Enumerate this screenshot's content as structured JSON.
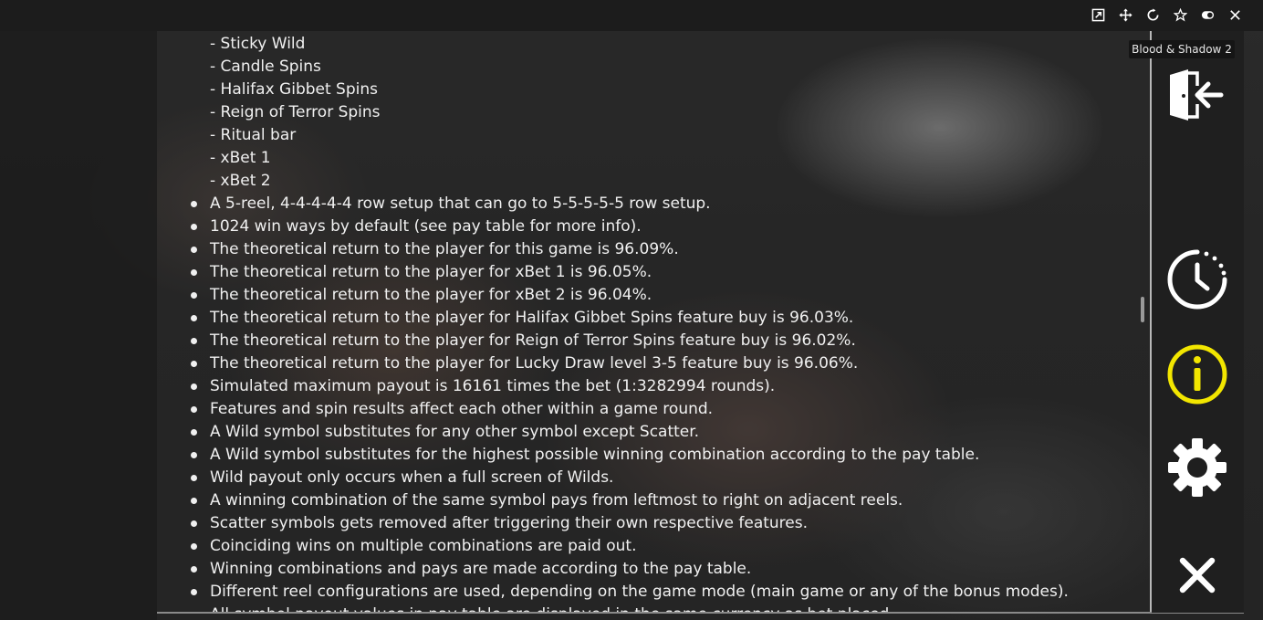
{
  "window": {
    "title": "Blood & Shadow 2",
    "top_controls": [
      "external-link-icon",
      "move-icon",
      "refresh-icon",
      "star-icon",
      "toggle-icon",
      "close-icon"
    ]
  },
  "help": {
    "sub_items": [
      "- Sticky Wild",
      "- Candle Spins",
      "- Halifax Gibbet Spins",
      "- Reign of Terror Spins",
      "- Ritual bar",
      "- xBet 1",
      "- xBet 2"
    ],
    "bullets": [
      "A 5-reel, 4-4-4-4-4 row setup that can go to 5-5-5-5-5 row setup.",
      "1024 win ways by default (see pay table for more info).",
      "The theoretical return to the player for this game is 96.09%.",
      "The theoretical return to the player for xBet 1 is 96.05%.",
      "The theoretical return to the player for xBet 2 is 96.04%.",
      "The theoretical return to the player for Halifax Gibbet Spins feature buy is 96.03%.",
      "The theoretical return to the player for Reign of Terror Spins feature buy is 96.02%.",
      "The theoretical return to the player for Lucky Draw level 3-5 feature buy is 96.06%.",
      "Simulated maximum payout is 16161 times the bet (1:3282994 rounds).",
      "Features and spin results affect each other within a game round.",
      "A Wild symbol substitutes for any other symbol except Scatter.",
      "A Wild symbol substitutes for the highest possible winning combination according to the pay table.",
      "Wild payout only occurs when a full screen of Wilds.",
      "A winning combination of the same symbol pays from leftmost to right on adjacent reels.",
      "Scatter symbols gets removed after triggering their own respective features.",
      "Coinciding wins on multiple combinations are paid out.",
      "Winning combinations and pays are made according to the pay table.",
      "Different reel configurations are used, depending on the game mode (main game or any of the bonus modes).",
      "All symbol payout values in pay table are displayed in the same currency as bet placed."
    ]
  },
  "menu": {
    "buttons": [
      "exit-icon",
      "history-icon",
      "info-icon",
      "settings-icon",
      "close-icon"
    ],
    "active": "info-icon",
    "active_color": "#f2e600",
    "icon_color": "#ffffff"
  }
}
